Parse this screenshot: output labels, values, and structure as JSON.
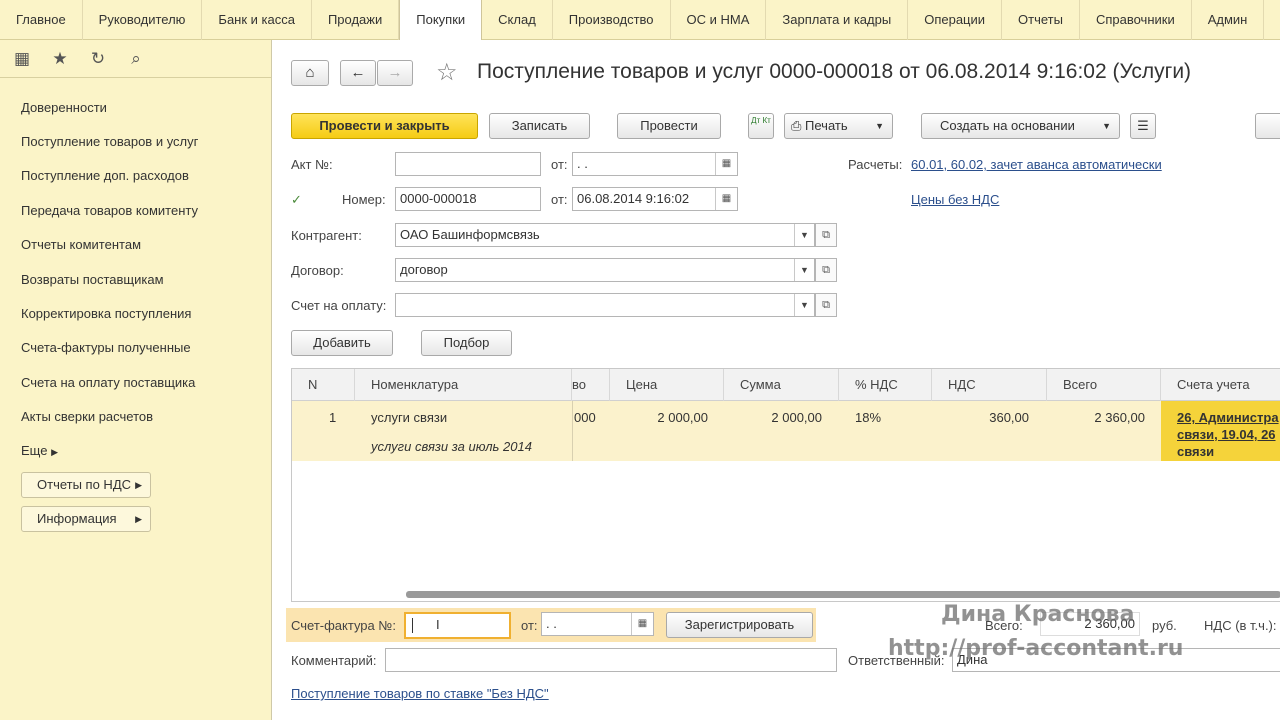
{
  "top_menu": [
    "Главное",
    "Руководителю",
    "Банк и касса",
    "Продажи",
    "Покупки",
    "Склад",
    "Производство",
    "ОС и НМА",
    "Зарплата и кадры",
    "Операции",
    "Отчеты",
    "Справочники",
    "Админ"
  ],
  "active_menu": "Покупки",
  "sidebar": {
    "items": [
      "Доверенности",
      "Поступление товаров и услуг",
      "Поступление доп. расходов",
      "Передача товаров комитенту",
      "Отчеты комитентам",
      "Возвраты поставщикам",
      "Корректировка поступления",
      "Счета-фактуры полученные",
      "Счета на оплату поставщика",
      "Акты сверки расчетов",
      "Еще"
    ],
    "buttons": [
      "Отчеты по НДС",
      "Информация"
    ]
  },
  "doc": {
    "title": "Поступление товаров и услуг 0000-000018 от 06.08.2014 9:16:02 (Услуги)"
  },
  "toolbar": {
    "post_close": "Провести и закрыть",
    "save": "Записать",
    "post": "Провести",
    "dt_kt": "Дт Кт",
    "print": "Печать",
    "create_basis": "Создать на основании"
  },
  "form": {
    "act_label": "Акт №:",
    "act_value": "",
    "from_label": "от:",
    "act_date": " .  .",
    "number_label": "Номер:",
    "number_value": "0000-000018",
    "date_value": "06.08.2014  9:16:02",
    "contractor_label": "Контрагент:",
    "contractor_value": "ОАО Башинформсвязь",
    "contract_label": "Договор:",
    "contract_value": "договор",
    "invoice_label": "Счет на оплату:",
    "invoice_value": "",
    "settlements_label": "Расчеты:",
    "settlements_link": "60.01, 60.02, зачет аванса автоматически",
    "prices_link": "Цены без НДС"
  },
  "table_buttons": {
    "add": "Добавить",
    "pick": "Подбор"
  },
  "table": {
    "headers": [
      "N",
      "Номенклатура",
      "во",
      "Цена",
      "Сумма",
      "% НДС",
      "НДС",
      "Всего",
      "Счета учета"
    ],
    "row": {
      "n": "1",
      "item": "услуги связи",
      "item_desc": "услуги связи за июль 2014",
      "qty_fragment": "000",
      "price": "2 000,00",
      "sum": "2 000,00",
      "vat_rate": "18%",
      "vat": "360,00",
      "total": "2 360,00",
      "accounts": [
        "26, Администра",
        "связи, 19.04, 26",
        "связи"
      ]
    }
  },
  "footer": {
    "sf_label": "Счет-фактура №:",
    "sf_value": "",
    "from_label": "от:",
    "sf_date": " .  .",
    "register": "Зарегистрировать",
    "total_label": "Всего:",
    "total_value": "2 360,00",
    "currency": "руб.",
    "vat_label": "НДС (в т.ч.):",
    "comment_label": "Комментарий:",
    "comment_value": "",
    "responsible_label": "Ответственный:",
    "responsible_value": "Дина",
    "bottom_link": "Поступление товаров по ставке \"Без НДС\""
  },
  "watermark": {
    "name": "Дина Краснова",
    "url": "http://prof-accontant.ru"
  }
}
